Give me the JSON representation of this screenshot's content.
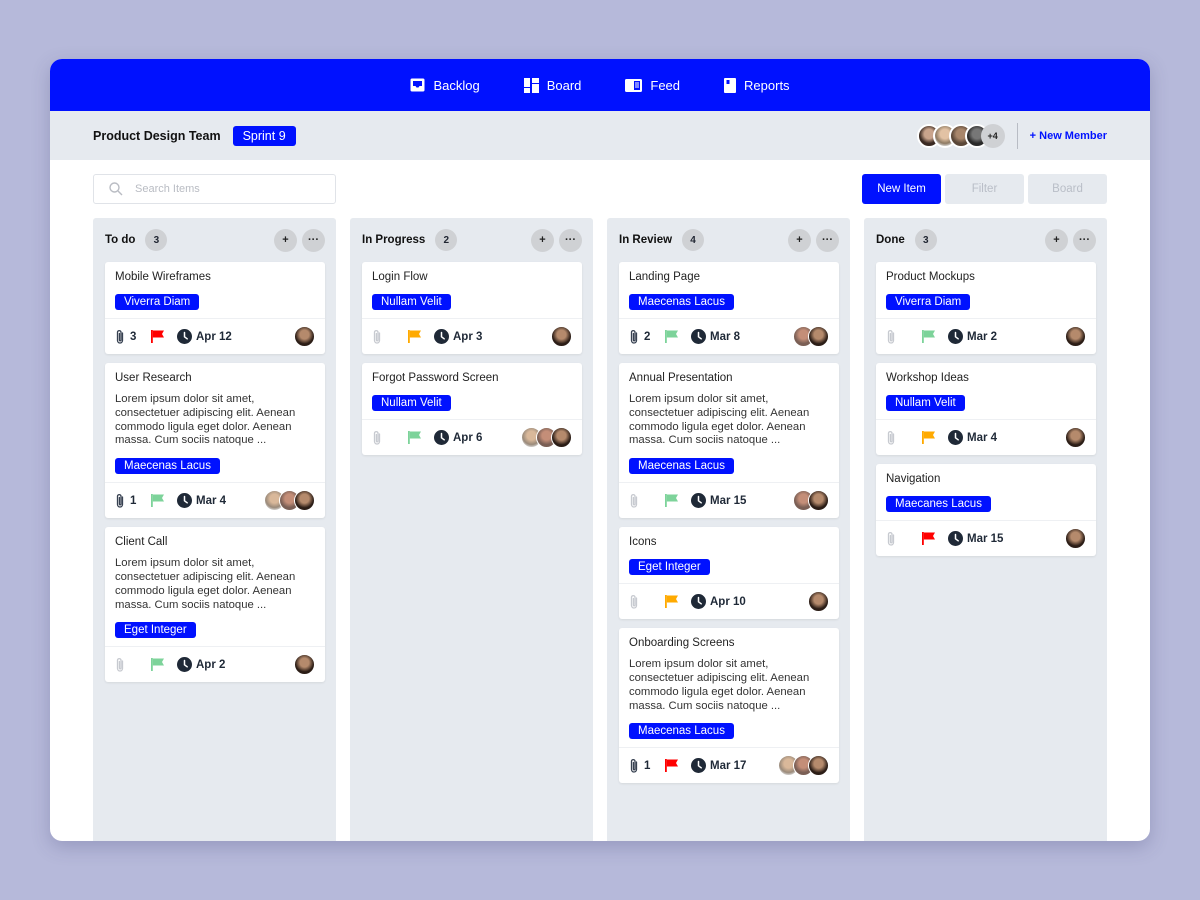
{
  "nav": {
    "items": [
      {
        "label": "Backlog",
        "icon": "inbox-icon"
      },
      {
        "label": "Board",
        "icon": "board-icon"
      },
      {
        "label": "Feed",
        "icon": "feed-icon"
      },
      {
        "label": "Reports",
        "icon": "reports-icon"
      }
    ]
  },
  "header": {
    "team": "Product Design Team",
    "sprint": "Sprint 9",
    "members_more": "+4",
    "new_member": "+ New Member"
  },
  "toolbar": {
    "search_placeholder": "Search Items",
    "new_item": "New Item",
    "filter": "Filter",
    "board": "Board"
  },
  "colors": {
    "brand": "#0011ff",
    "flag_red": "#ff0000",
    "flag_green": "#7dd39a",
    "flag_orange": "#ffaa00"
  },
  "columns": [
    {
      "title": "To do",
      "count": "3",
      "cards": [
        {
          "title": "Mobile Wireframes",
          "desc": "",
          "tag": "Viverra Diam",
          "attachments": "3",
          "flag": "red",
          "date": "Apr 12",
          "avatars": 1
        },
        {
          "title": "User Research",
          "desc": "Lorem ipsum dolor sit amet, consectetuer adipiscing elit. Aenean commodo ligula eget dolor. Aenean massa. Cum sociis natoque ...",
          "tag": "Maecenas Lacus",
          "attachments": "1",
          "flag": "green",
          "date": "Mar 4",
          "avatars": 3
        },
        {
          "title": "Client Call",
          "desc": "Lorem ipsum dolor sit amet, consectetuer adipiscing elit. Aenean commodo ligula eget dolor. Aenean massa. Cum sociis natoque ...",
          "tag": "Eget Integer",
          "attachments": "",
          "flag": "green",
          "date": "Apr 2",
          "avatars": 1
        }
      ]
    },
    {
      "title": "In Progress",
      "count": "2",
      "cards": [
        {
          "title": "Login Flow",
          "desc": "",
          "tag": "Nullam Velit",
          "attachments": "",
          "flag": "orange",
          "date": "Apr 3",
          "avatars": 1
        },
        {
          "title": "Forgot Password Screen",
          "desc": "",
          "tag": "Nullam Velit",
          "attachments": "",
          "flag": "green",
          "date": "Apr 6",
          "avatars": 3
        }
      ]
    },
    {
      "title": "In Review",
      "count": "4",
      "cards": [
        {
          "title": "Landing Page",
          "desc": "",
          "tag": "Maecenas Lacus",
          "attachments": "2",
          "flag": "green",
          "date": "Mar 8",
          "avatars": 2
        },
        {
          "title": "Annual Presentation",
          "desc": "Lorem ipsum dolor sit amet, consectetuer adipiscing elit. Aenean commodo ligula eget dolor. Aenean massa. Cum sociis natoque ...",
          "tag": "Maecenas Lacus",
          "attachments": "",
          "flag": "green",
          "date": "Mar 15",
          "avatars": 2
        },
        {
          "title": "Icons",
          "desc": "",
          "tag": "Eget Integer",
          "attachments": "",
          "flag": "orange",
          "date": "Apr 10",
          "avatars": 1
        },
        {
          "title": "Onboarding Screens",
          "desc": "Lorem ipsum dolor sit amet, consectetuer adipiscing elit. Aenean commodo ligula eget dolor. Aenean massa. Cum sociis natoque ...",
          "tag": "Maecenas Lacus",
          "attachments": "1",
          "flag": "red",
          "date": "Mar 17",
          "avatars": 3
        }
      ]
    },
    {
      "title": "Done",
      "count": "3",
      "cards": [
        {
          "title": "Product Mockups",
          "desc": "",
          "tag": "Viverra Diam",
          "attachments": "",
          "flag": "green",
          "date": "Mar 2",
          "avatars": 1
        },
        {
          "title": "Workshop Ideas",
          "desc": "",
          "tag": "Nullam Velit",
          "attachments": "",
          "flag": "orange",
          "date": "Mar 4",
          "avatars": 1
        },
        {
          "title": "Navigation",
          "desc": "",
          "tag": "Maecanes Lacus",
          "attachments": "",
          "flag": "red",
          "date": "Mar 15",
          "avatars": 1
        }
      ]
    }
  ]
}
